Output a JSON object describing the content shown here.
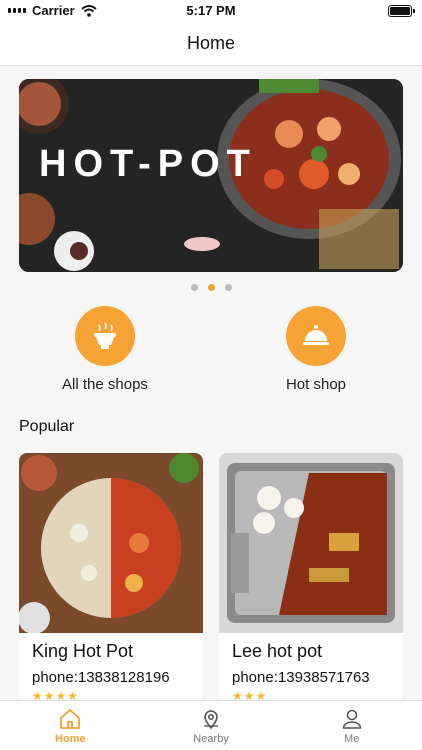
{
  "status_bar": {
    "carrier": "Carrier",
    "time": "5:17 PM"
  },
  "header": {
    "title": "Home"
  },
  "banner": {
    "title": "HOT-POT",
    "slide_count": 3,
    "active_slide": 2
  },
  "categories": [
    {
      "label": "All the shops",
      "icon": "hotpot-icon"
    },
    {
      "label": "Hot shop",
      "icon": "cloche-icon"
    }
  ],
  "popular": {
    "title": "Popular",
    "shops": [
      {
        "name": "King Hot Pot",
        "phone": "phone:13838128196",
        "rating": 4
      },
      {
        "name": "Lee hot pot",
        "phone": "phone:13938571763",
        "rating": 3
      }
    ]
  },
  "tabs": [
    {
      "label": "Home",
      "icon": "home-icon",
      "active": true
    },
    {
      "label": "Nearby",
      "icon": "location-pin-icon",
      "active": false
    },
    {
      "label": "Me",
      "icon": "user-icon",
      "active": false
    }
  ],
  "colors": {
    "accent": "#f0a22e",
    "icon_bg": "#f7a234",
    "star": "#f5b82e"
  }
}
